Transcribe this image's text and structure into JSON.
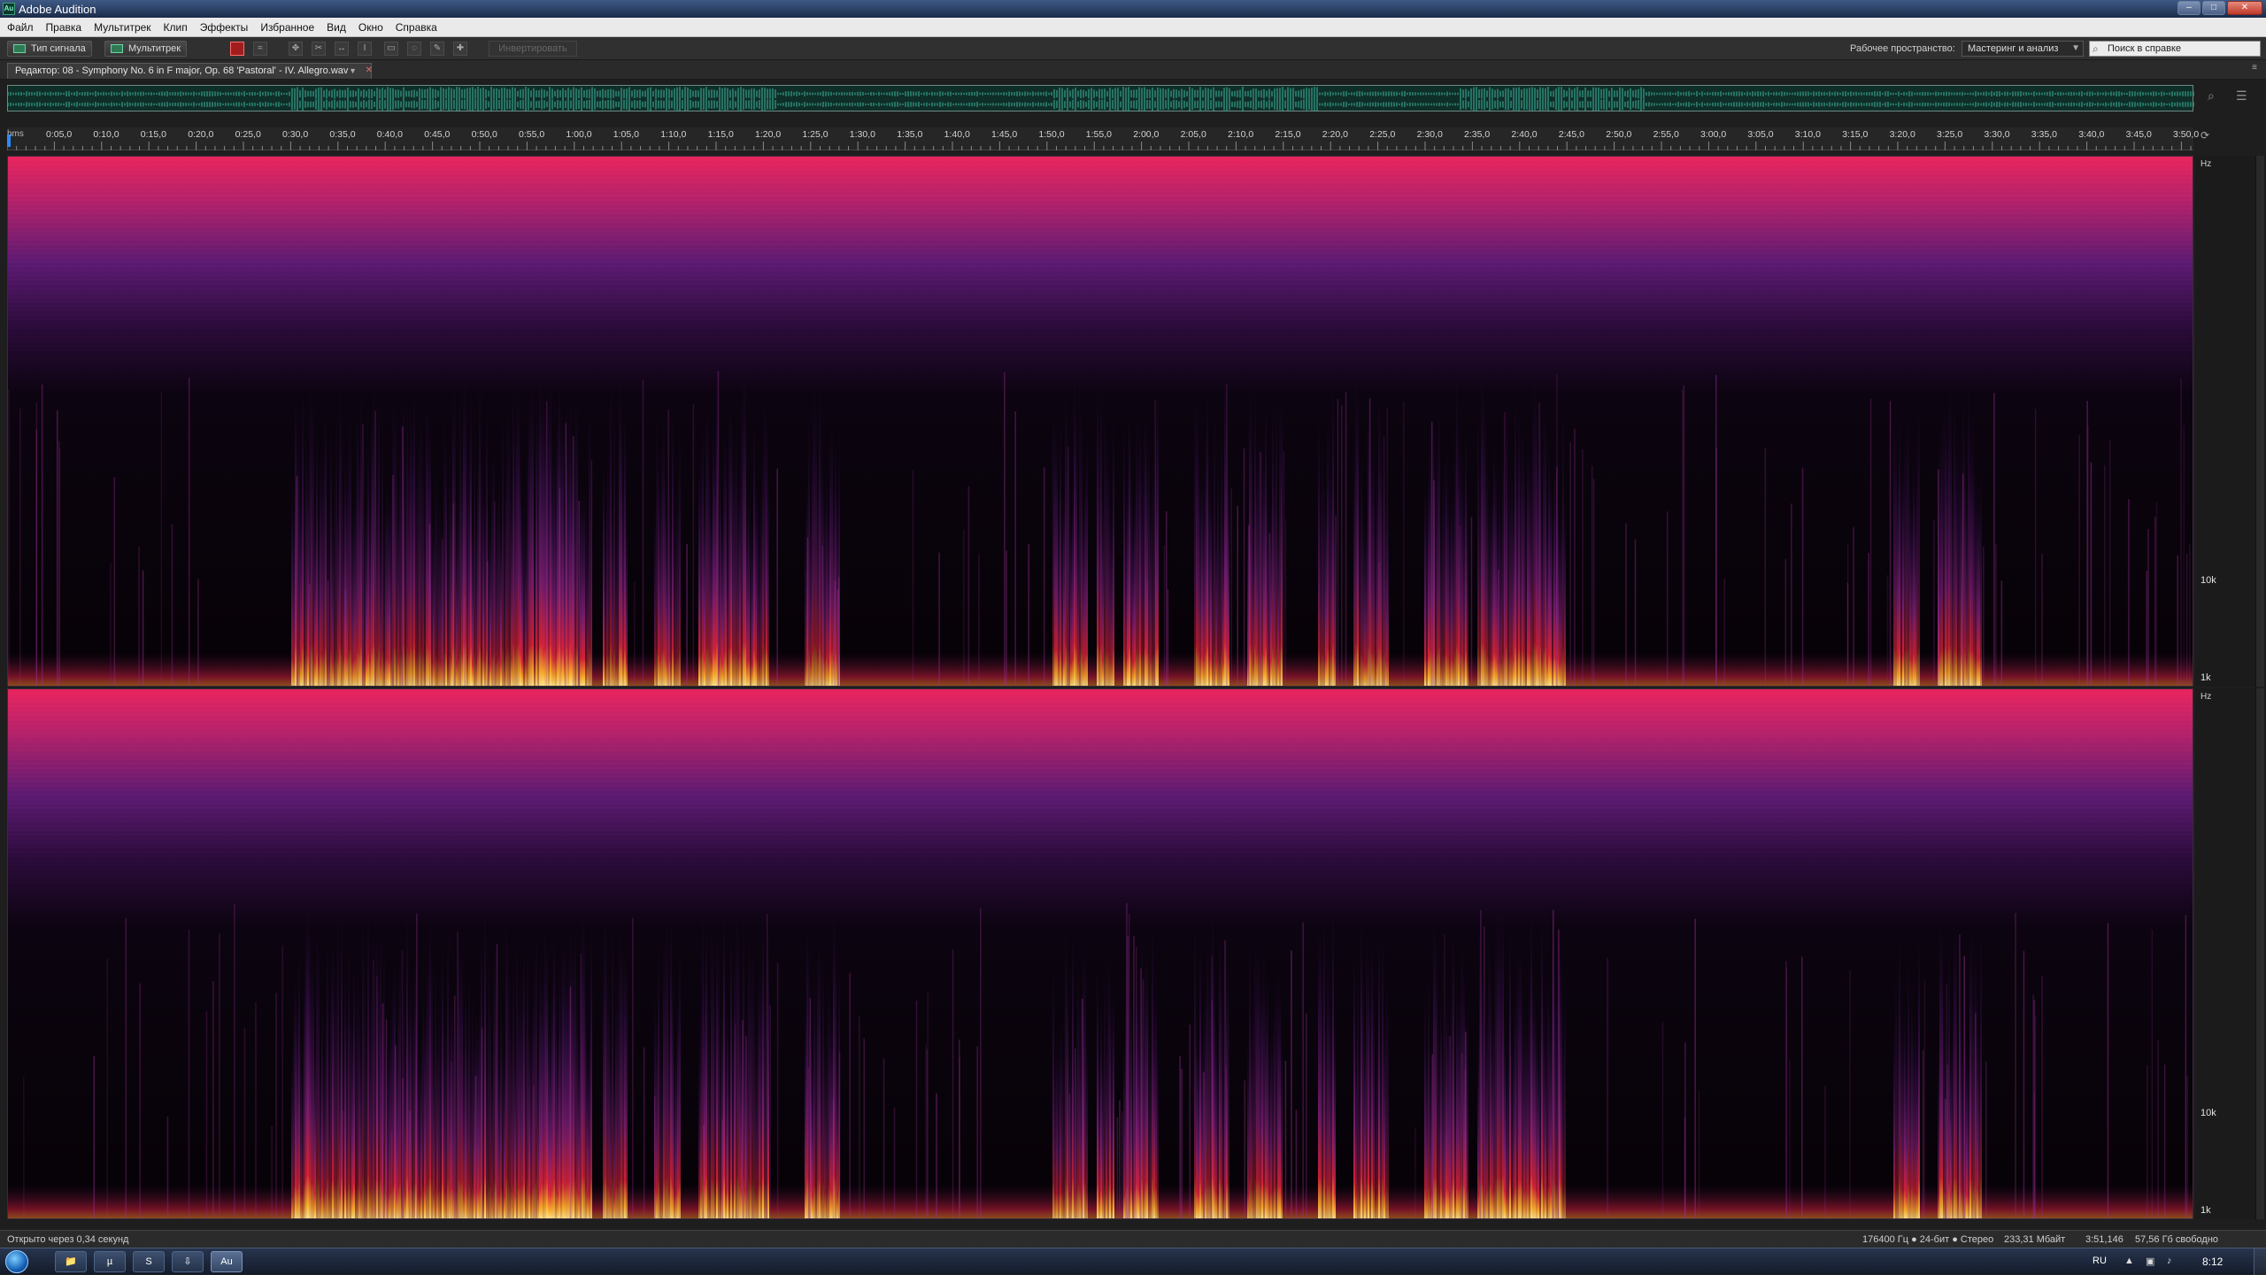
{
  "window": {
    "title": "Adobe Audition",
    "app_icon_text": "Au",
    "controls": {
      "minimize": "–",
      "maximize": "□",
      "close": "✕"
    }
  },
  "menu": [
    "Файл",
    "Правка",
    "Мультитрек",
    "Клип",
    "Эффекты",
    "Избранное",
    "Вид",
    "Окно",
    "Справка"
  ],
  "toolbar": {
    "waveform_label": "Тип сигнала",
    "multitrack_label": "Мультитрек",
    "invert_label": "Инвертировать",
    "workspace_label": "Рабочее пространство:",
    "workspace_value": "Мастеринг и анализ",
    "help_search_placeholder": "Поиск в справке",
    "tool_icons": [
      "spectral-red-icon",
      "waveform-icon",
      "move-icon",
      "razor-icon",
      "slip-icon",
      "time-select-icon",
      "marquee-icon",
      "lasso-icon",
      "brush-icon",
      "healing-icon"
    ]
  },
  "editor_tab": {
    "label": "Редактор: 08 - Symphony No. 6 in F major, Op. 68 'Pastoral' - IV. Allegro.wav",
    "dropdown": "▼",
    "close": "✕"
  },
  "ruler": {
    "unit": "hms",
    "labels": [
      "0:05,0",
      "0:10,0",
      "0:15,0",
      "0:20,0",
      "0:25,0",
      "0:30,0",
      "0:35,0",
      "0:40,0",
      "0:45,0",
      "0:50,0",
      "0:55,0",
      "1:00,0",
      "1:05,0",
      "1:10,0",
      "1:15,0",
      "1:20,0",
      "1:25,0",
      "1:30,0",
      "1:35,0",
      "1:40,0",
      "1:45,0",
      "1:50,0",
      "1:55,0",
      "2:00,0",
      "2:05,0",
      "2:10,0",
      "2:15,0",
      "2:20,0",
      "2:25,0",
      "2:30,0",
      "2:35,0",
      "2:40,0",
      "2:45,0",
      "2:50,0",
      "2:55,0",
      "3:00,0",
      "3:05,0",
      "3:10,0",
      "3:15,0",
      "3:20,0",
      "3:25,0",
      "3:30,0",
      "3:35,0",
      "3:40,0",
      "3:45,0",
      "3:50,0"
    ]
  },
  "frequency_scale": {
    "unit": "Hz",
    "labels": [
      "10k",
      "1k"
    ]
  },
  "status": {
    "left": "Открыто через 0,34 секунд",
    "format": "176400 Гц ● 24-бит ● Стерео",
    "size": "233,31 Мбайт",
    "duration": "3:51,146",
    "free": "57,56 Гб свободно"
  },
  "taskbar": {
    "language": "RU",
    "clock": "8:12",
    "apps": [
      "explorer-icon",
      "utorrent-icon",
      "skype-icon",
      "download-icon",
      "audition-icon"
    ],
    "app_glyphs": [
      "📁",
      "µ",
      "S",
      "⇩",
      "Au"
    ]
  },
  "colors": {
    "spectrum_top": "#e8245e",
    "spectrum_mid": "#5b1a72",
    "spectrum_low": "#ffcf3a",
    "accent": "#2c8bff"
  }
}
